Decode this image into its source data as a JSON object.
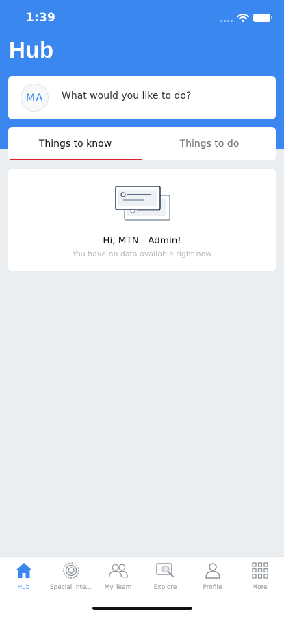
{
  "status_bar": {
    "time": "1:39"
  },
  "header": {
    "title": "Hub",
    "background_color": "#3b87f0"
  },
  "composer": {
    "avatar_initials": "MA",
    "prompt": "What would you like to do?"
  },
  "tabs": [
    {
      "label": "Things to know",
      "active": true
    },
    {
      "label": "Things to do",
      "active": false
    }
  ],
  "tab_indicator_color": "#e0252f",
  "empty_state": {
    "illustration": "message-cards-illustration",
    "title": "Hi, MTN - Admin!",
    "subtitle": "You have no data available right now"
  },
  "bottom_nav": {
    "items": [
      {
        "label": "Hub",
        "icon": "home-icon",
        "active": true
      },
      {
        "label": "Special Inte...",
        "icon": "special-interest-icon",
        "active": false
      },
      {
        "label": "My Team",
        "icon": "team-icon",
        "active": false
      },
      {
        "label": "Explore",
        "icon": "explore-icon",
        "active": false
      },
      {
        "label": "Profile",
        "icon": "profile-icon",
        "active": false
      },
      {
        "label": "More",
        "icon": "grid-icon",
        "active": false
      }
    ],
    "active_color": "#3b87f0",
    "inactive_color": "#8e9499"
  }
}
